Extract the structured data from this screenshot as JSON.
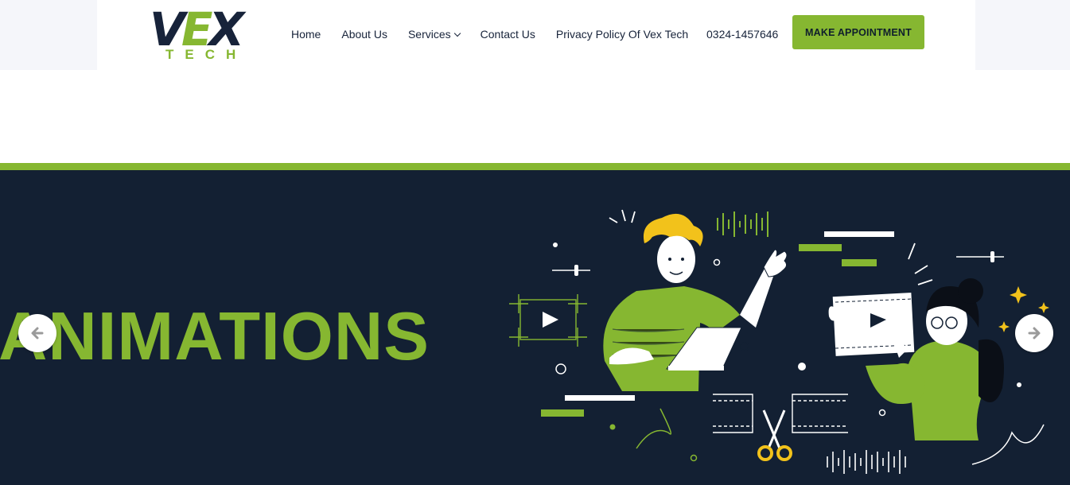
{
  "logo": {
    "main_left": "V",
    "main_mid": "E",
    "main_right": "X",
    "sub": "TECH"
  },
  "nav": {
    "items": [
      {
        "label": "Home"
      },
      {
        "label": "About Us"
      },
      {
        "label": "Services",
        "has_dropdown": true
      },
      {
        "label": "Contact Us"
      },
      {
        "label": "Privacy Policy Of Vex Tech"
      }
    ]
  },
  "header": {
    "phone": "0324-1457646",
    "cta_label": "MAKE APPOINTMENT"
  },
  "hero": {
    "title": "ANIMATIONS",
    "prev_icon": "arrow-left-icon",
    "next_icon": "arrow-right-icon"
  },
  "colors": {
    "accent": "#86b731",
    "navy": "#132033",
    "text": "#17233a"
  }
}
